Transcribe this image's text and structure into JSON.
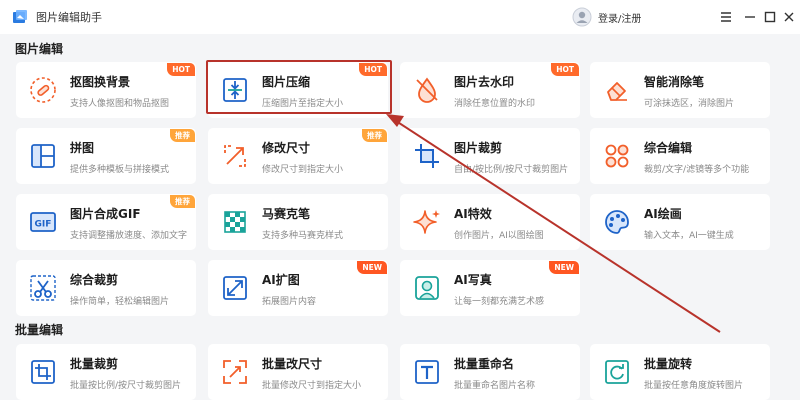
{
  "app": {
    "title": "图片编辑助手",
    "login_label": "登录/注册"
  },
  "sections": {
    "edit": "图片编辑",
    "batch": "批量编辑"
  },
  "cards": [
    {
      "title": "抠图换背景",
      "desc": "支持人像抠图和物品抠图",
      "badge": "HOT",
      "icon": "cutout-icon"
    },
    {
      "title": "图片压缩",
      "desc": "压缩图片至指定大小",
      "badge": "HOT",
      "icon": "compress-icon"
    },
    {
      "title": "图片去水印",
      "desc": "消除任意位置的水印",
      "badge": "HOT",
      "icon": "watermark-remove-icon"
    },
    {
      "title": "智能消除笔",
      "desc": "可涂抹选区，消除图片",
      "badge": "",
      "icon": "eraser-icon"
    },
    {
      "title": "拼图",
      "desc": "提供多种模板与拼接模式",
      "badge": "推荐",
      "icon": "collage-icon"
    },
    {
      "title": "修改尺寸",
      "desc": "修改尺寸到指定大小",
      "badge": "推荐",
      "icon": "resize-icon"
    },
    {
      "title": "图片裁剪",
      "desc": "自由/按比例/按尺寸裁剪图片",
      "badge": "",
      "icon": "crop-icon"
    },
    {
      "title": "综合编辑",
      "desc": "裁剪/文字/滤镜等多个功能",
      "badge": "",
      "icon": "multi-edit-icon"
    },
    {
      "title": "图片合成GIF",
      "desc": "支持调整播放速度、添加文字",
      "badge": "推荐",
      "icon": "gif-icon"
    },
    {
      "title": "马赛克笔",
      "desc": "支持多种马赛克样式",
      "badge": "",
      "icon": "mosaic-icon"
    },
    {
      "title": "AI特效",
      "desc": "创作图片，AI以图绘图",
      "badge": "",
      "icon": "sparkle-icon"
    },
    {
      "title": "AI绘画",
      "desc": "输入文本，AI一键生成",
      "badge": "",
      "icon": "palette-icon"
    },
    {
      "title": "综合裁剪",
      "desc": "操作简单，轻松编辑图片",
      "badge": "",
      "icon": "scissors-icon"
    },
    {
      "title": "AI扩图",
      "desc": "拓展图片内容",
      "badge": "NEW",
      "icon": "expand-icon"
    },
    {
      "title": "AI写真",
      "desc": "让每一刻都充满艺术感",
      "badge": "NEW",
      "icon": "portrait-icon"
    },
    {
      "title": "批量裁剪",
      "desc": "批量按比例/按尺寸裁剪图片",
      "badge": "",
      "icon": "batch-crop-icon"
    },
    {
      "title": "批量改尺寸",
      "desc": "批量修改尺寸到指定大小",
      "badge": "",
      "icon": "batch-resize-icon"
    },
    {
      "title": "批量重命名",
      "desc": "批量重命名图片名称",
      "badge": "",
      "icon": "batch-rename-icon"
    },
    {
      "title": "批量旋转",
      "desc": "批量按任意角度旋转图片",
      "badge": "",
      "icon": "batch-rotate-icon"
    }
  ],
  "colors": {
    "accent": "#ff6a2b",
    "highlight": "#b8332b",
    "icon_blue": "#1e63c8",
    "icon_orange": "#f25f2a",
    "icon_teal": "#1aa39a"
  }
}
